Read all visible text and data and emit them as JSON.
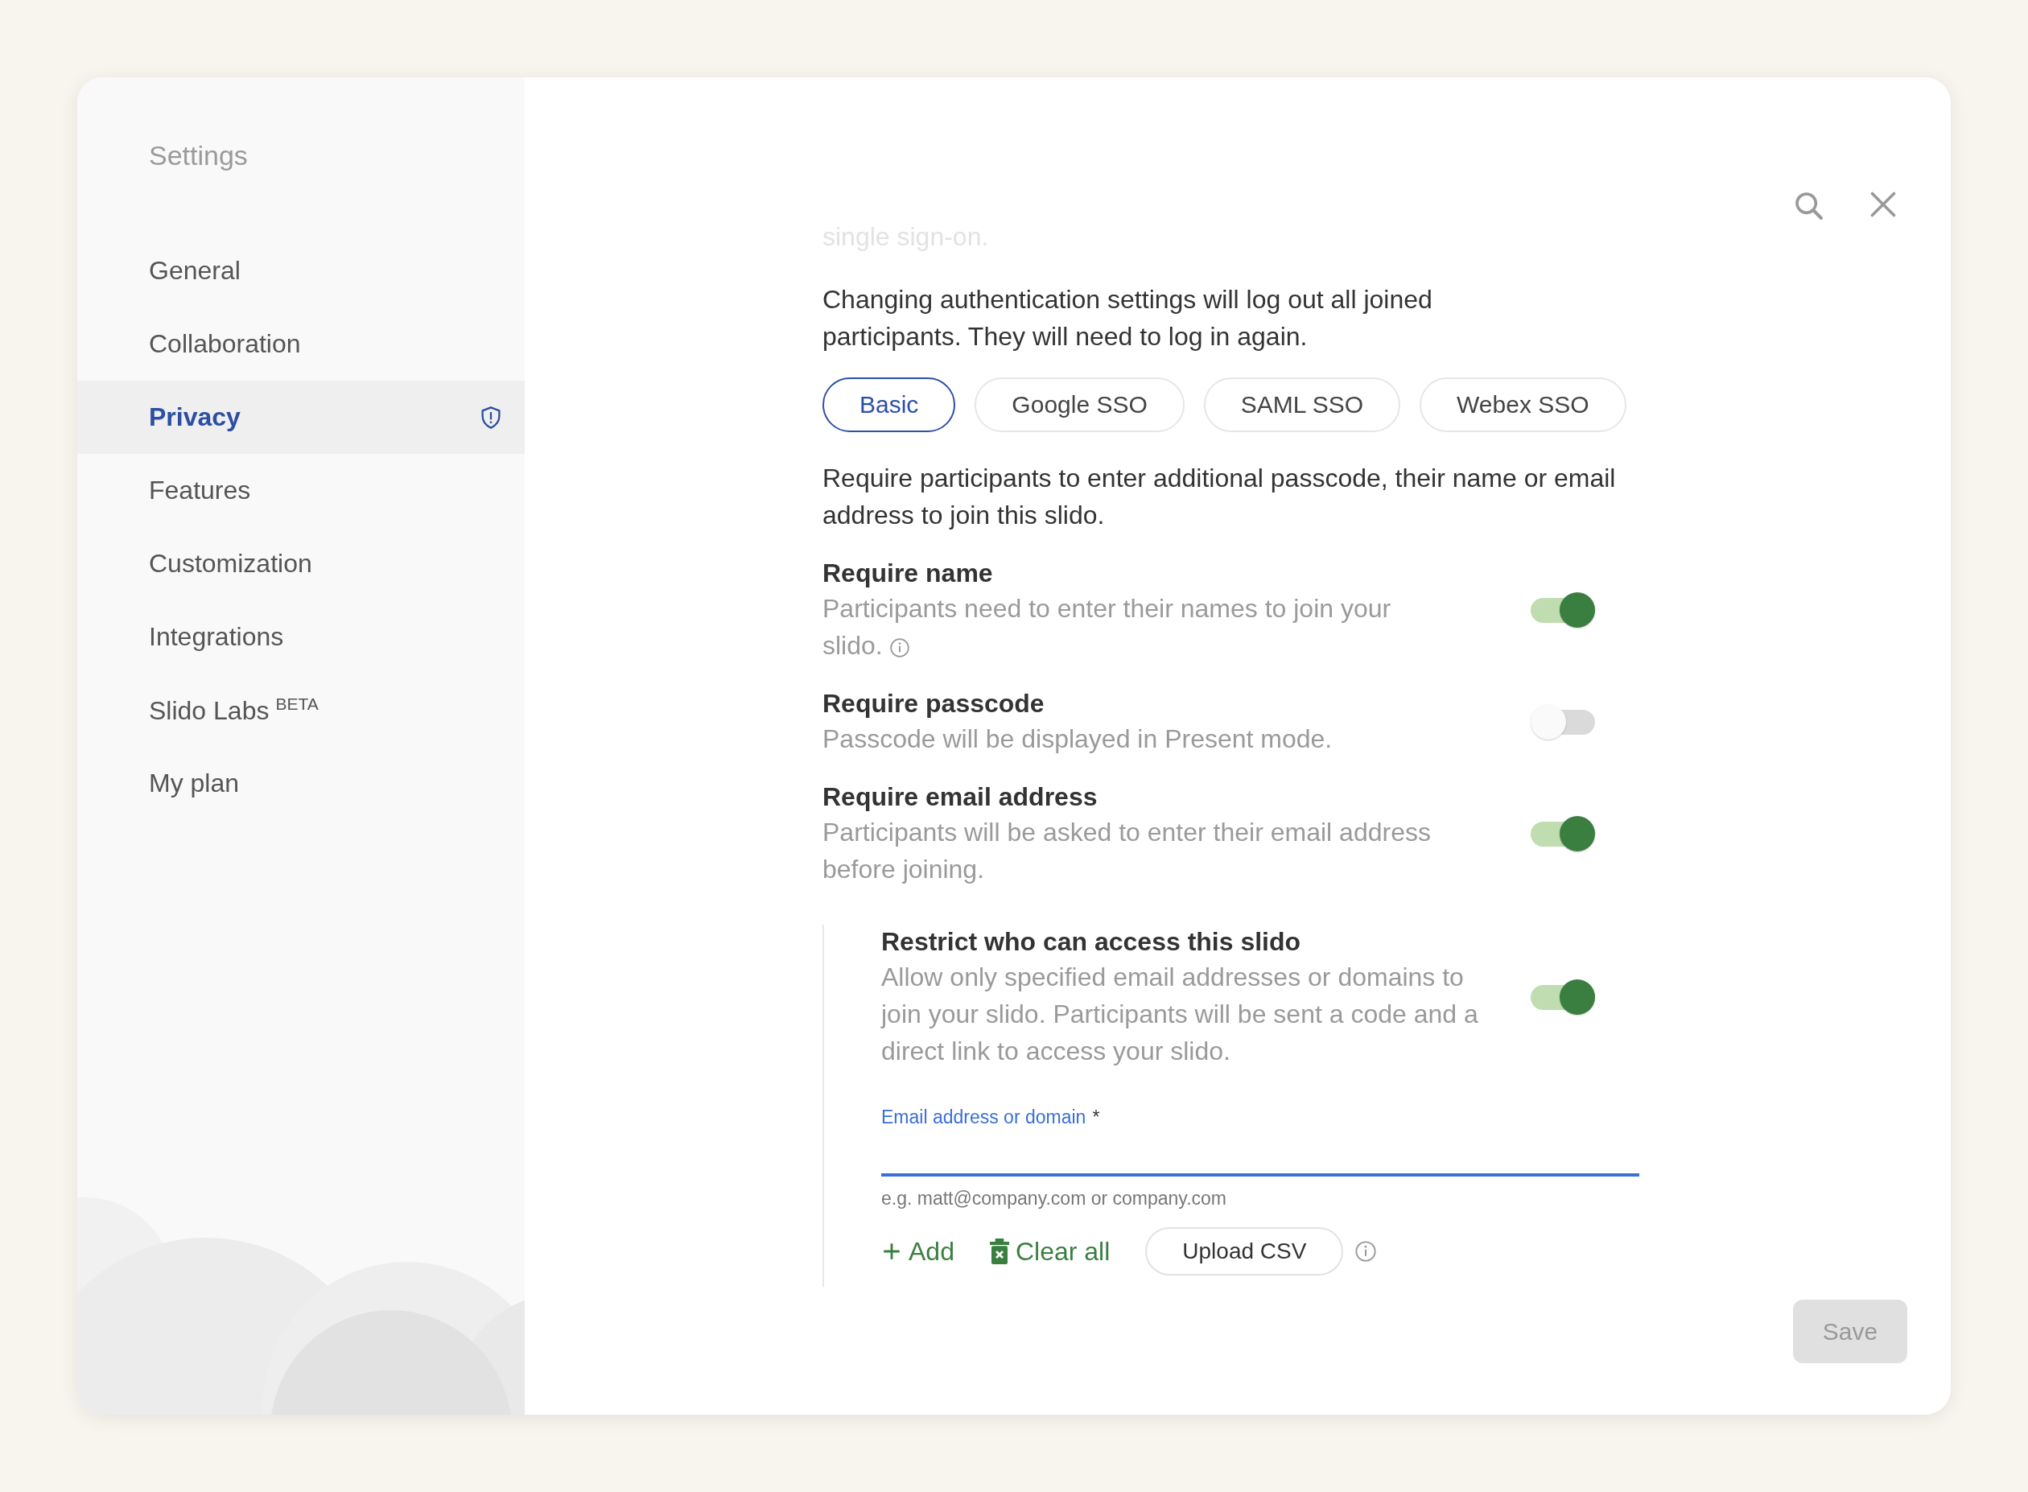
{
  "window": {
    "title": "Settings"
  },
  "sidebar": {
    "items": [
      {
        "label": "General",
        "selected": false,
        "kind": "plain"
      },
      {
        "label": "Collaboration",
        "selected": false,
        "kind": "plain"
      },
      {
        "label": "Privacy",
        "selected": true,
        "kind": "alert"
      },
      {
        "label": "Features",
        "selected": false,
        "kind": "plain"
      },
      {
        "label": "Customization",
        "selected": false,
        "kind": "plain"
      },
      {
        "label": "Integrations",
        "selected": false,
        "kind": "plain"
      },
      {
        "label": "Slido Labs",
        "superscript": "BETA",
        "selected": false,
        "kind": "plain"
      },
      {
        "label": "My plan",
        "selected": false,
        "kind": "plain"
      }
    ]
  },
  "faded_text": "single sign-on.",
  "notice": "Changing authentication settings will log out all joined participants. They will need to log in again.",
  "auth_tabs": [
    {
      "label": "Basic",
      "selected": true
    },
    {
      "label": "Google SSO",
      "selected": false
    },
    {
      "label": "SAML SSO",
      "selected": false
    },
    {
      "label": "Webex SSO",
      "selected": false
    }
  ],
  "intro": "Require participants to enter additional passcode, their name or email address to join this slido.",
  "options": [
    {
      "title": "Require name",
      "description": "Participants need to enter their names to join your slido.",
      "info": true,
      "on": true
    },
    {
      "title": "Require passcode",
      "description": "Passcode will be displayed in Present mode.",
      "info": false,
      "on": false
    },
    {
      "title": "Require email address",
      "description": "Participants will be asked to enter their email address before joining.",
      "info": false,
      "on": true
    }
  ],
  "restriction": {
    "title": "Restrict who can access this slido",
    "description": "Allow only specified email addresses or domains to join your slido. Participants will be sent a code and a direct link to access your slido.",
    "on": true,
    "field": {
      "label": "Email address or domain",
      "required_mark": "*",
      "hint": "e.g. matt@company.com or company.com",
      "focused": true
    },
    "actions": [
      {
        "kind": "add",
        "label": "Add"
      },
      {
        "kind": "clear",
        "label": "Clear all"
      },
      {
        "kind": "upload",
        "label": "Upload CSV"
      }
    ]
  },
  "save_button": {
    "label": "Save",
    "disabled": true
  }
}
